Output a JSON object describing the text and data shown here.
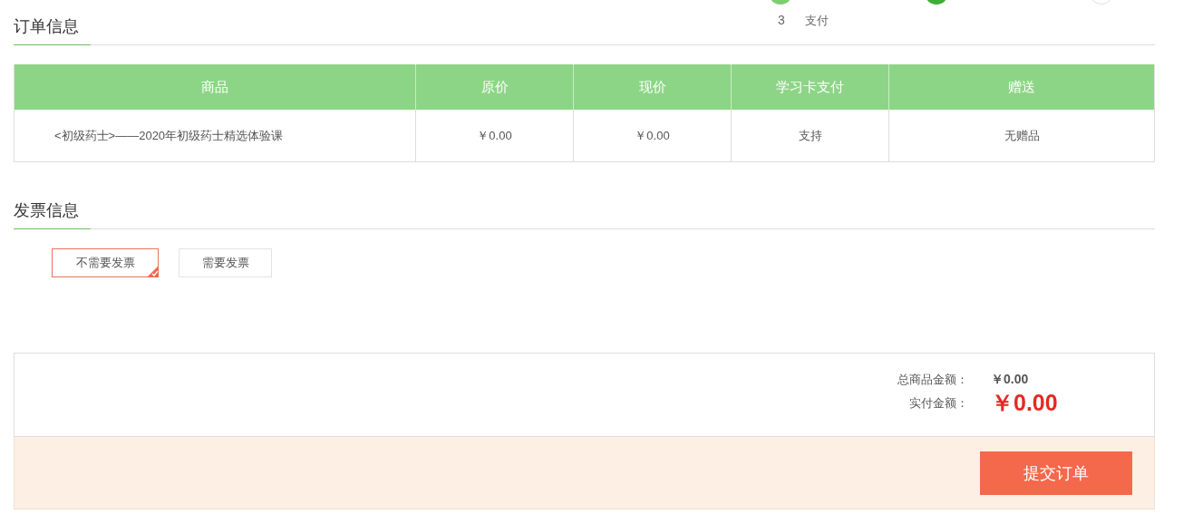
{
  "steps": [
    {
      "color": "#7ccf6f"
    },
    {
      "color": "#3fae36"
    },
    {
      "color": "#ffffff"
    }
  ],
  "step_caption": {
    "number": "3",
    "label": "支付"
  },
  "order_section": {
    "title": "订单信息"
  },
  "table": {
    "columns": [
      "商品",
      "原价",
      "现价",
      "学习卡支付",
      "赠送"
    ],
    "rows": [
      [
        "<初级药士>——2020年初级药士精选体验课",
        "￥0.00",
        "￥0.00",
        "支持",
        "无赠品"
      ]
    ]
  },
  "invoice_section": {
    "title": "发票信息",
    "options": [
      {
        "label": "不需要发票",
        "selected": true
      },
      {
        "label": "需要发票",
        "selected": false
      }
    ]
  },
  "summary": {
    "total_label": "总商品金额：",
    "total_value": "￥0.00",
    "paid_label": "实付金额：",
    "paid_value": "￥0.00"
  },
  "submit_button": "提交订单"
}
